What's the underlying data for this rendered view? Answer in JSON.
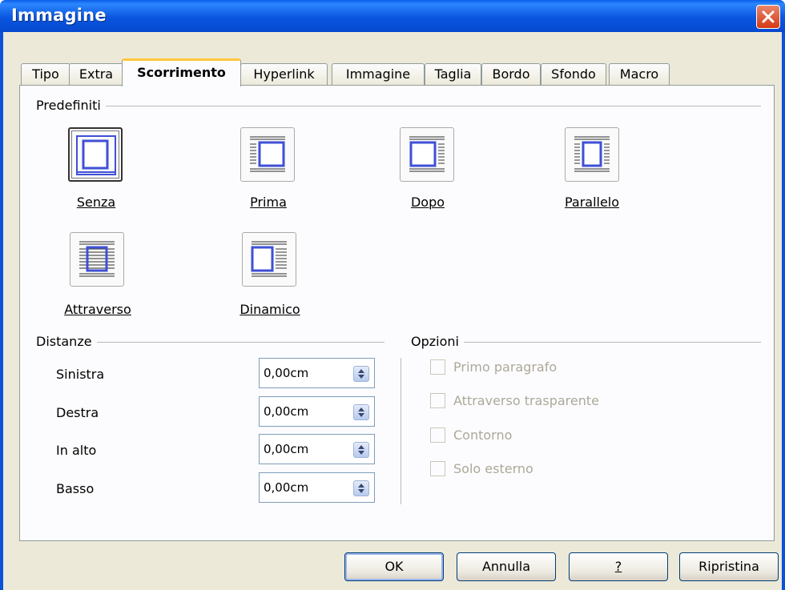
{
  "window": {
    "title": "Immagine"
  },
  "tabs": [
    {
      "label": "Tipo"
    },
    {
      "label": "Extra"
    },
    {
      "label": "Scorrimento",
      "active": true
    },
    {
      "label": "Hyperlink"
    },
    {
      "label": "Immagine"
    },
    {
      "label": "Taglia"
    },
    {
      "label": "Bordo"
    },
    {
      "label": "Sfondo"
    },
    {
      "label": "Macro"
    }
  ],
  "predefiniti": {
    "title": "Predefiniti",
    "options": [
      {
        "label": "Senza",
        "selected": true
      },
      {
        "label": "Prima",
        "selected": false
      },
      {
        "label": "Dopo",
        "selected": false
      },
      {
        "label": "Parallelo",
        "selected": false
      },
      {
        "label": "Attraverso",
        "selected": false
      },
      {
        "label": "Dinamico",
        "selected": false
      }
    ]
  },
  "distanze": {
    "title": "Distanze",
    "fields": [
      {
        "label": "Sinistra",
        "value": "0,00cm"
      },
      {
        "label": "Destra",
        "value": "0,00cm"
      },
      {
        "label": "In alto",
        "value": "0,00cm"
      },
      {
        "label": "Basso",
        "value": "0,00cm"
      }
    ]
  },
  "opzioni": {
    "title": "Opzioni",
    "items": [
      {
        "label": "Primo paragrafo",
        "checked": false,
        "enabled": false
      },
      {
        "label": "Attraverso trasparente",
        "checked": false,
        "enabled": false
      },
      {
        "label": "Contorno",
        "checked": false,
        "enabled": false
      },
      {
        "label": "Solo esterno",
        "checked": false,
        "enabled": false
      }
    ]
  },
  "buttons": {
    "ok": "OK",
    "cancel": "Annulla",
    "help": "?",
    "reset": "Ripristina"
  },
  "colors": {
    "titlebar": "#0a56df",
    "tab_highlight": "#ffc83c",
    "icon_frame": "#3f50d6"
  }
}
